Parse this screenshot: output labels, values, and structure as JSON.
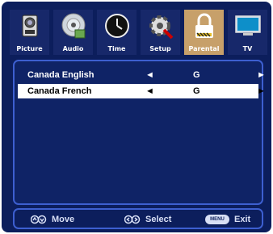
{
  "tabs": [
    {
      "label": "Picture",
      "icon": "camera-icon"
    },
    {
      "label": "Audio",
      "icon": "disc-icon"
    },
    {
      "label": "Time",
      "icon": "clock-icon"
    },
    {
      "label": "Setup",
      "icon": "gear-icon"
    },
    {
      "label": "Parental",
      "icon": "lock-icon",
      "active": true
    },
    {
      "label": "TV",
      "icon": "tv-icon"
    }
  ],
  "rows": [
    {
      "name": "Canada English",
      "left": "◄",
      "value": "G",
      "right": "►"
    },
    {
      "name": "Canada French",
      "left": "◄",
      "value": "G",
      "right": "►",
      "selected": true
    }
  ],
  "footer": {
    "move": "Move",
    "select": "Select",
    "menu_key": "MENU",
    "exit": "Exit"
  },
  "colors": {
    "background": "#0c1e5c",
    "active_tab": "#c7a06a",
    "border": "#3d5fd0",
    "selected_row": "#ffffff"
  }
}
